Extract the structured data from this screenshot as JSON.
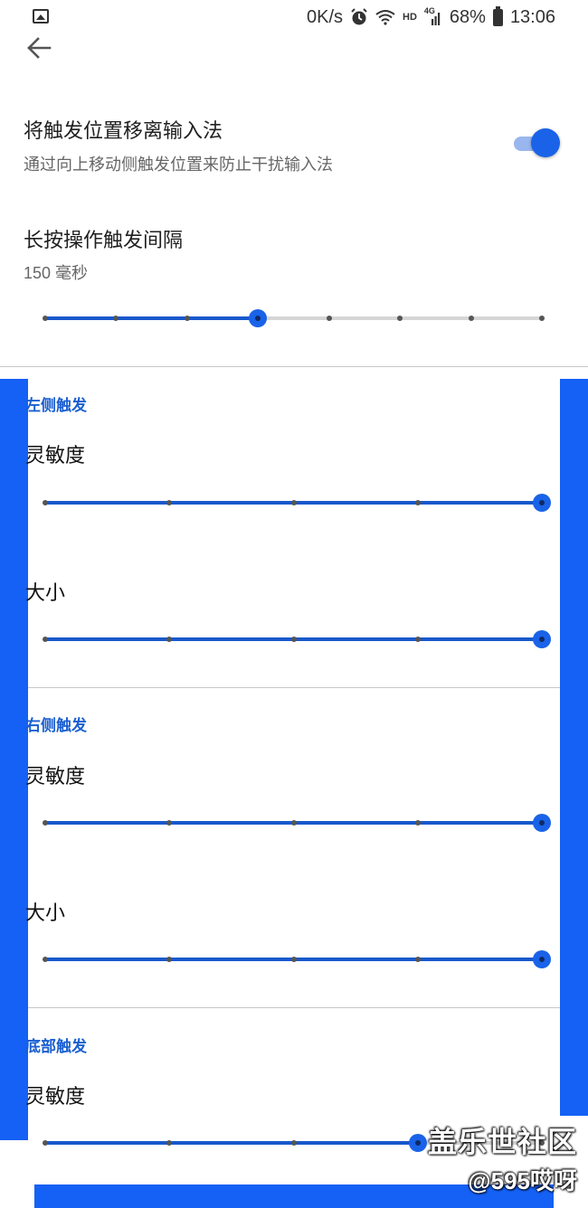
{
  "status_bar": {
    "net_speed": "0K/s",
    "hd_label": "HD",
    "signal_label": "4G",
    "battery": "68%",
    "time": "13:06",
    "icons": [
      "image-icon",
      "alarm-icon",
      "wifi-icon",
      "signal-icon",
      "battery-icon"
    ]
  },
  "header": {
    "back_icon": "back-arrow-icon"
  },
  "move_trigger": {
    "title": "将触发位置移离输入法",
    "subtitle": "通过向上移动侧触发位置来防止干扰输入法",
    "enabled": true
  },
  "long_press": {
    "title": "长按操作触发间隔",
    "value_text": "150 毫秒",
    "slider": {
      "steps": 8,
      "selected_index": 3
    }
  },
  "left_trigger": {
    "header": "左侧触发",
    "sensitivity_label": "灵敏度",
    "sensitivity_slider": {
      "steps": 5,
      "selected_index": 4
    },
    "size_label": "大小",
    "size_slider": {
      "steps": 5,
      "selected_index": 4
    }
  },
  "right_trigger": {
    "header": "右侧触发",
    "sensitivity_label": "灵敏度",
    "sensitivity_slider": {
      "steps": 5,
      "selected_index": 4
    },
    "size_label": "大小",
    "size_slider": {
      "steps": 5,
      "selected_index": 4
    }
  },
  "bottom_trigger": {
    "header": "底部触发",
    "sensitivity_label": "灵敏度",
    "sensitivity_slider": {
      "steps": 5,
      "selected_index": 3
    }
  },
  "watermark": {
    "line1": "盖乐世社区",
    "line2": "@595哎呀"
  },
  "colors": {
    "accent": "#1a63e8",
    "overlay_blue": "#1560f5",
    "section_header": "#1a5fd0"
  }
}
